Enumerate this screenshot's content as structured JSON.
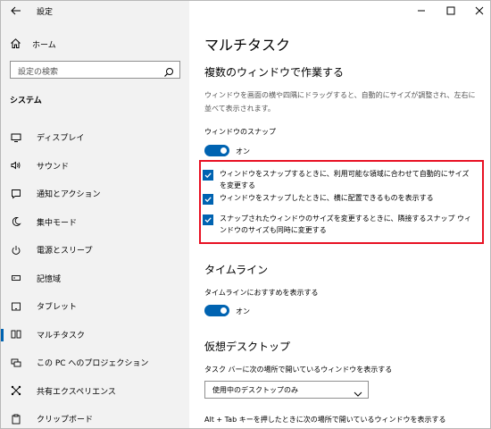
{
  "window": {
    "title": "設定"
  },
  "sidebar": {
    "home_label": "ホーム",
    "search_placeholder": "設定の検索",
    "section_label": "システム",
    "items": [
      {
        "label": "ディスプレイ",
        "icon": "display-icon"
      },
      {
        "label": "サウンド",
        "icon": "speaker-icon"
      },
      {
        "label": "通知とアクション",
        "icon": "notification-icon"
      },
      {
        "label": "集中モード",
        "icon": "moon-icon"
      },
      {
        "label": "電源とスリープ",
        "icon": "power-icon"
      },
      {
        "label": "記憶域",
        "icon": "storage-icon"
      },
      {
        "label": "タブレット",
        "icon": "tablet-icon"
      },
      {
        "label": "マルチタスク",
        "icon": "multitask-icon",
        "active": true
      },
      {
        "label": "この PC へのプロジェクション",
        "icon": "projection-icon"
      },
      {
        "label": "共有エクスペリエンス",
        "icon": "shared-icon"
      },
      {
        "label": "クリップボード",
        "icon": "clipboard-icon"
      }
    ]
  },
  "main": {
    "title": "マルチタスク",
    "snap_section": {
      "heading": "複数のウィンドウで作業する",
      "description": "ウィンドウを画面の横や四隅にドラッグすると、自動的にサイズが調整され、左右に並べて表示されます。",
      "toggle_label": "ウィンドウのスナップ",
      "toggle_state": "オン",
      "checkboxes": [
        {
          "label": "ウィンドウをスナップするときに、利用可能な領域に合わせて自動的にサイズを変更する",
          "checked": true
        },
        {
          "label": "ウィンドウをスナップしたときに、横に配置できるものを表示する",
          "checked": true
        },
        {
          "label": "スナップされたウィンドウのサイズを変更するときに、隣接するスナップ ウィンドウのサイズも同時に変更する",
          "checked": true
        }
      ]
    },
    "timeline_section": {
      "heading": "タイムライン",
      "toggle_label": "タイムラインにおすすめを表示する",
      "toggle_state": "オン"
    },
    "desktop_section": {
      "heading": "仮想デスクトップ",
      "taskbar_label": "タスク バーに次の場所で開いているウィンドウを表示する",
      "taskbar_value": "使用中のデスクトップのみ",
      "alttab_label": "Alt + Tab キーを押したときに次の場所で開いているウィンドウを表示する"
    }
  },
  "colors": {
    "accent": "#0063b1",
    "highlight_border": "#e81123",
    "sidebar_bg": "#f2f2f2"
  }
}
